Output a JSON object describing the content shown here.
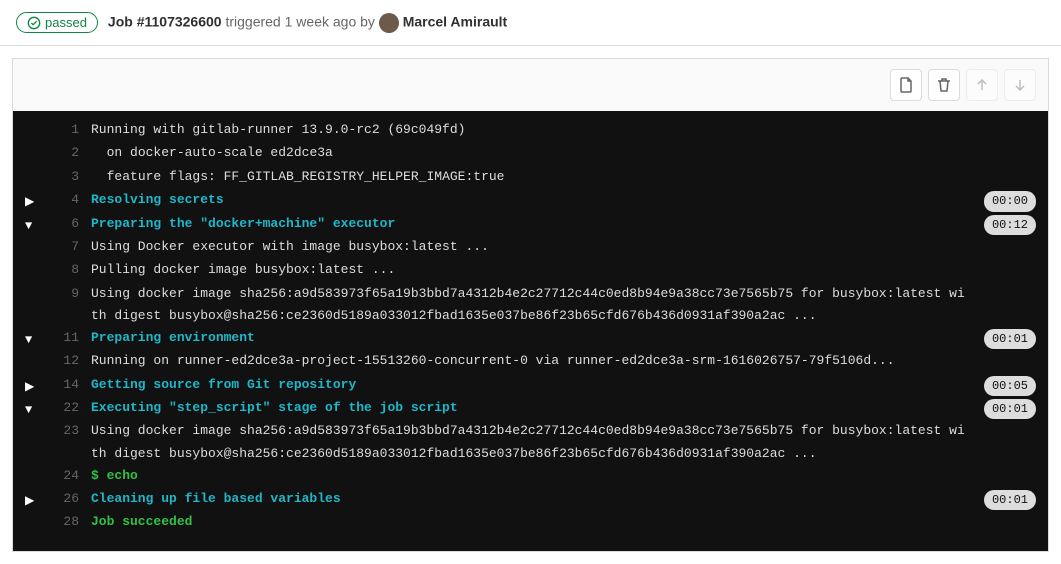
{
  "status": {
    "label": "passed"
  },
  "job": {
    "prefix": "Job ",
    "id": "#1107326600",
    "triggered": " triggered ",
    "ago": "1 week ago",
    "by": " by ",
    "author": "Marcel Amirault"
  },
  "lines": [
    {
      "n": 1,
      "caret": "",
      "cls": "",
      "dur": "",
      "text": "Running with gitlab-runner 13.9.0-rc2 (69c049fd)"
    },
    {
      "n": 2,
      "caret": "",
      "cls": "",
      "dur": "",
      "text": "  on docker-auto-scale ed2dce3a"
    },
    {
      "n": 3,
      "caret": "",
      "cls": "",
      "dur": "",
      "text": "  feature flags: FF_GITLAB_REGISTRY_HELPER_IMAGE:true"
    },
    {
      "n": 4,
      "caret": "right",
      "cls": "header-cyan",
      "dur": "00:00",
      "text": "Resolving secrets"
    },
    {
      "n": 6,
      "caret": "down",
      "cls": "header-cyan",
      "dur": "00:12",
      "text": "Preparing the \"docker+machine\" executor"
    },
    {
      "n": 7,
      "caret": "",
      "cls": "",
      "dur": "",
      "text": "Using Docker executor with image busybox:latest ..."
    },
    {
      "n": 8,
      "caret": "",
      "cls": "",
      "dur": "",
      "text": "Pulling docker image busybox:latest ..."
    },
    {
      "n": 9,
      "caret": "",
      "cls": "",
      "dur": "",
      "text": "Using docker image sha256:a9d583973f65a19b3bbd7a4312b4e2c27712c44c0ed8b94e9a38cc73e7565b75 for busybox:latest with digest busybox@sha256:ce2360d5189a033012fbad1635e037be86f23b65cfd676b436d0931af390a2ac ..."
    },
    {
      "n": 11,
      "caret": "down",
      "cls": "header-cyan",
      "dur": "00:01",
      "text": "Preparing environment"
    },
    {
      "n": 12,
      "caret": "",
      "cls": "",
      "dur": "",
      "text": "Running on runner-ed2dce3a-project-15513260-concurrent-0 via runner-ed2dce3a-srm-1616026757-79f5106d..."
    },
    {
      "n": 14,
      "caret": "right",
      "cls": "header-cyan",
      "dur": "00:05",
      "text": "Getting source from Git repository"
    },
    {
      "n": 22,
      "caret": "down",
      "cls": "header-cyan",
      "dur": "00:01",
      "text": "Executing \"step_script\" stage of the job script"
    },
    {
      "n": 23,
      "caret": "",
      "cls": "",
      "dur": "",
      "text": "Using docker image sha256:a9d583973f65a19b3bbd7a4312b4e2c27712c44c0ed8b94e9a38cc73e7565b75 for busybox:latest with digest busybox@sha256:ce2360d5189a033012fbad1635e037be86f23b65cfd676b436d0931af390a2ac ..."
    },
    {
      "n": 24,
      "caret": "",
      "cls": "green",
      "dur": "",
      "text": "$ echo"
    },
    {
      "n": 26,
      "caret": "right",
      "cls": "header-cyan",
      "dur": "00:01",
      "text": "Cleaning up file based variables"
    },
    {
      "n": 28,
      "caret": "",
      "cls": "green",
      "dur": "",
      "text": "Job succeeded"
    }
  ]
}
